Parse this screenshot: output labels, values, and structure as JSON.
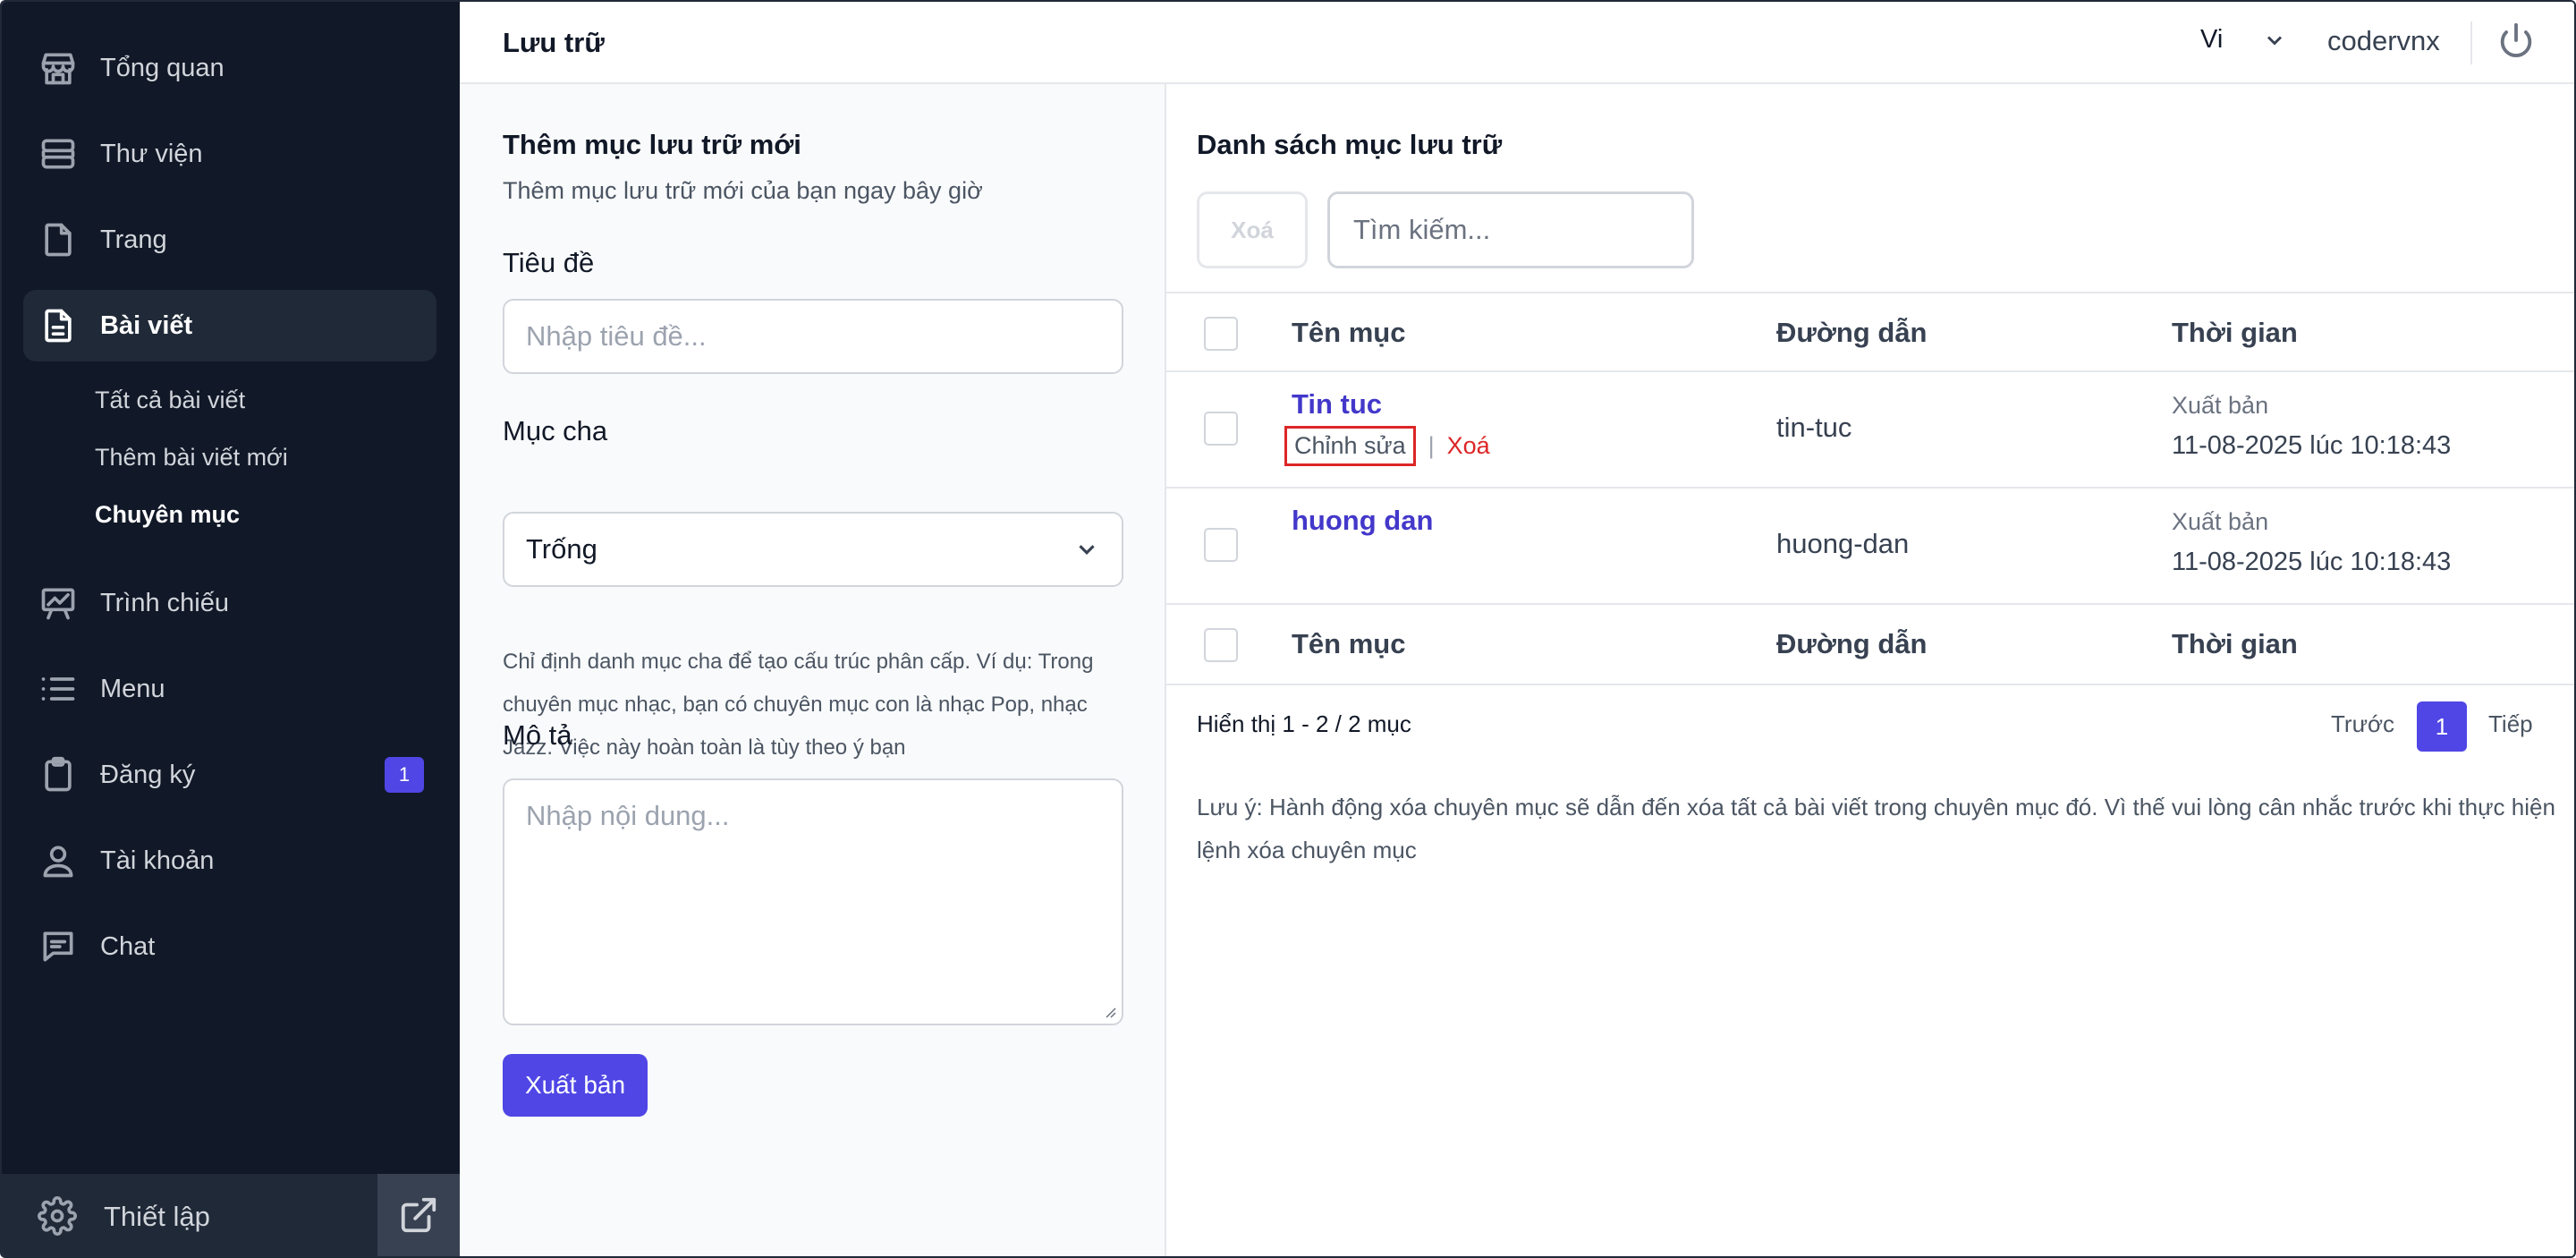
{
  "sidebar": {
    "items": [
      {
        "label": "Tổng quan",
        "icon": "store-icon"
      },
      {
        "label": "Thư viện",
        "icon": "database-icon"
      },
      {
        "label": "Trang",
        "icon": "file-icon"
      },
      {
        "label": "Bài viết",
        "icon": "document-text-icon"
      },
      {
        "label": "Trình chiếu",
        "icon": "presentation-chart-icon"
      },
      {
        "label": "Menu",
        "icon": "list-icon"
      },
      {
        "label": "Đăng ký",
        "icon": "clipboard-icon",
        "badge": "1"
      },
      {
        "label": "Tài khoản",
        "icon": "user-icon"
      },
      {
        "label": "Chat",
        "icon": "chat-icon"
      }
    ],
    "subitems": [
      {
        "label": "Tất cả bài viết"
      },
      {
        "label": "Thêm bài viết mới"
      },
      {
        "label": "Chuyên mục"
      }
    ],
    "footer": {
      "settings_label": "Thiết lập"
    }
  },
  "header": {
    "title": "Lưu trữ",
    "language": "Vi",
    "username": "codervnx"
  },
  "form": {
    "heading": "Thêm mục lưu trữ mới",
    "subheading": "Thêm mục lưu trữ mới của bạn ngay bây giờ",
    "title_label": "Tiêu đề",
    "title_placeholder": "Nhập tiêu đề...",
    "parent_label": "Mục cha",
    "parent_value": "Trống",
    "parent_help": "Chỉ định danh mục cha để tạo cấu trúc phân cấp. Ví dụ: Trong chuyên mục nhạc, bạn có chuyên mục con là nhạc Pop, nhạc Jazz. Việc này hoàn toàn là tùy theo ý bạn",
    "description_label": "Mô tả",
    "description_placeholder": "Nhập nội dung...",
    "publish_label": "Xuất bản"
  },
  "list": {
    "heading": "Danh sách mục lưu trữ",
    "delete_label": "Xoá",
    "search_placeholder": "Tìm kiếm...",
    "columns": {
      "name": "Tên mục",
      "slug": "Đường dẫn",
      "time": "Thời gian"
    },
    "rows": [
      {
        "name": "Tin tuc",
        "slug": "tin-tuc",
        "status": "Xuất bản",
        "date": "11-08-2025 lúc 10:18:43",
        "edit_label": "Chỉnh sửa",
        "delete_label": "Xoá"
      },
      {
        "name": "huong dan",
        "slug": "huong-dan",
        "status": "Xuất bản",
        "date": "11-08-2025 lúc 10:18:43"
      }
    ],
    "paging": {
      "info": "Hiển thị 1 - 2 / 2 mục",
      "prev": "Trước",
      "current": "1",
      "next": "Tiếp"
    },
    "note": "Lưu ý: Hành động xóa chuyên mục sẽ dẫn đến xóa tất cả bài viết trong chuyên mục đó. Vì thế vui lòng cân nhắc trước khi thực hiện lệnh xóa chuyên mục"
  },
  "colors": {
    "sidebar_bg": "#111827",
    "accent": "#4f46e5",
    "link": "#4338ca",
    "danger": "#dc2626"
  }
}
